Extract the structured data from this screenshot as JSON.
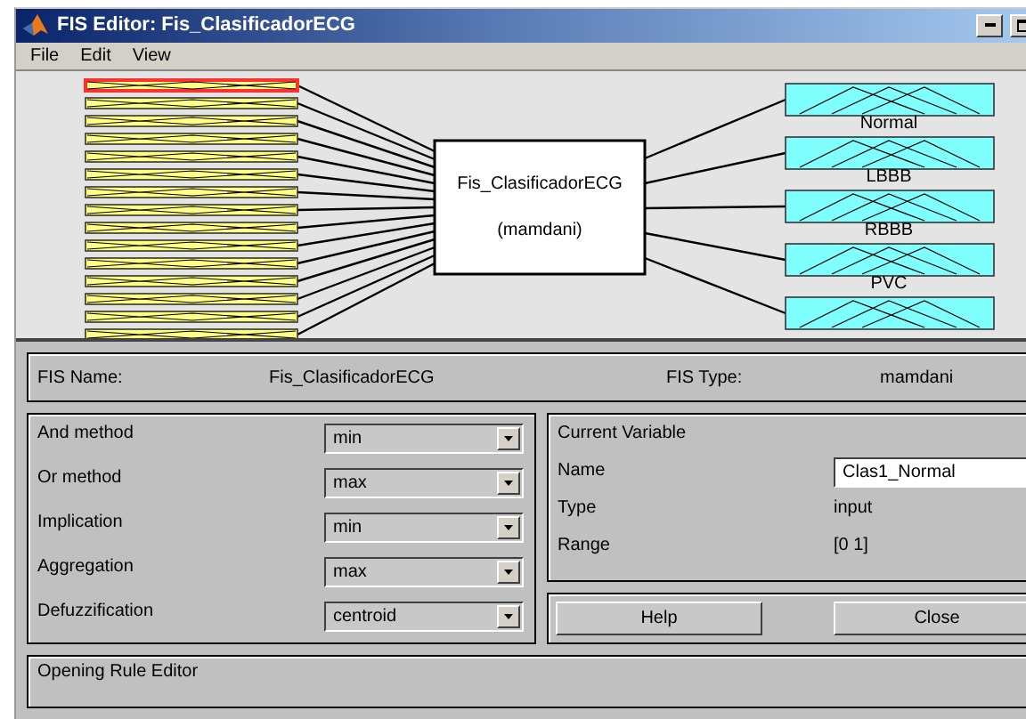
{
  "window": {
    "title": "FIS Editor: Fis_ClasificadorECG"
  },
  "menu": [
    {
      "label": "File"
    },
    {
      "label": "Edit"
    },
    {
      "label": "View"
    }
  ],
  "diagram": {
    "system_name": "Fis_ClasificadorECG",
    "system_type": "(mamdani)",
    "inputs": [
      {
        "selected": true
      },
      {
        "selected": false
      },
      {
        "selected": false
      },
      {
        "selected": false
      },
      {
        "selected": false
      },
      {
        "selected": false
      },
      {
        "selected": false
      },
      {
        "selected": false
      },
      {
        "selected": false
      },
      {
        "selected": false
      },
      {
        "selected": false
      },
      {
        "selected": false
      },
      {
        "selected": false
      },
      {
        "selected": false
      },
      {
        "selected": false
      }
    ],
    "outputs": [
      {
        "kind": "triangles",
        "label": "Normal"
      },
      {
        "kind": "triangles",
        "label": "LBBB"
      },
      {
        "kind": "triangles",
        "label": "RBBB"
      },
      {
        "kind": "triangles",
        "label": "PVC"
      },
      {
        "kind": "triangles"
      }
    ]
  },
  "fis": {
    "name_label": "FIS Name:",
    "name": "Fis_ClasificadorECG",
    "type_label": "FIS Type:",
    "type": "mamdani"
  },
  "methods": [
    {
      "label": "And method",
      "value": "min"
    },
    {
      "label": "Or method",
      "value": "max"
    },
    {
      "label": "Implication",
      "value": "min"
    },
    {
      "label": "Aggregation",
      "value": "max"
    },
    {
      "label": "Defuzzification",
      "value": "centroid"
    }
  ],
  "current_variable": {
    "title": "Current Variable",
    "name_label": "Name",
    "name": "Clas1_Normal",
    "type_label": "Type",
    "type": "input",
    "range_label": "Range",
    "range": "[0 1]"
  },
  "buttons": [
    {
      "label": "Help"
    },
    {
      "label": "Close"
    }
  ],
  "status": "Opening Rule Editor"
}
